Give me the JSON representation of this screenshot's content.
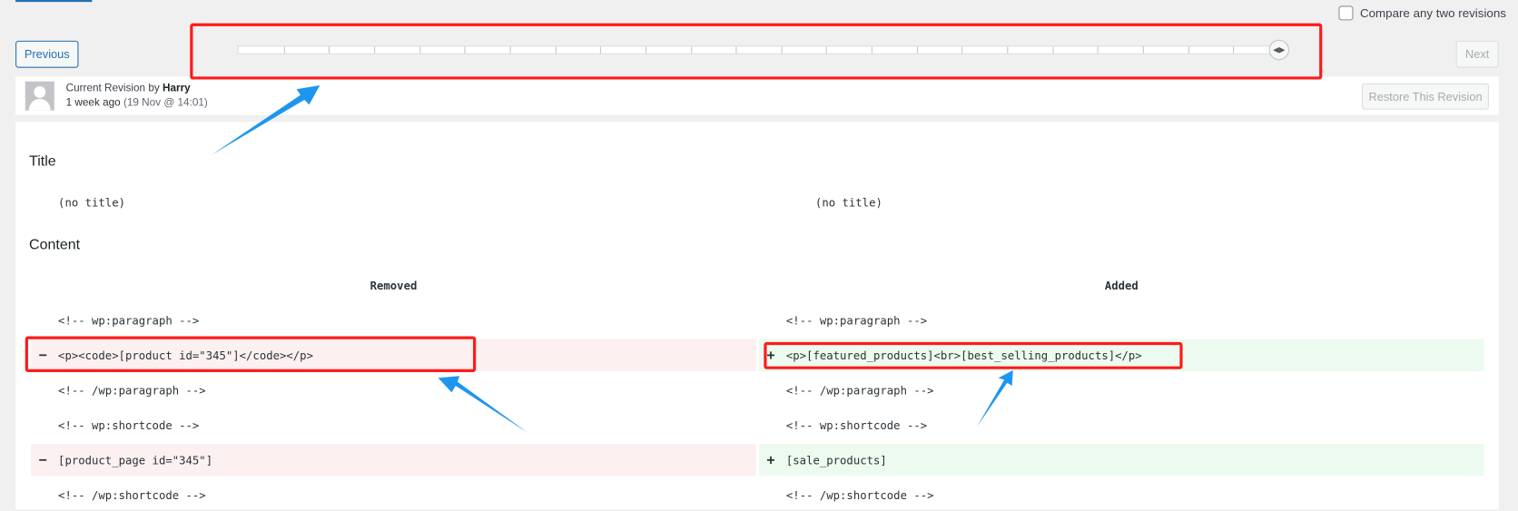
{
  "header": {
    "compare_label": "Compare any two revisions",
    "compare_checked": false,
    "previous_label": "Previous",
    "next_label": "Next",
    "restore_label": "Restore This Revision",
    "revision_prefix": "Current Revision by ",
    "author": "Harry",
    "time_ago": "1 week ago",
    "date": "(19 Nov @ 14:01)",
    "slider_segments": 23,
    "slider_position": 1.0
  },
  "diff": {
    "title_heading": "Title",
    "title_left": "(no title)",
    "title_right": "(no title)",
    "content_heading": "Content",
    "removed_header": "Removed",
    "added_header": "Added",
    "rows": [
      {
        "type": "context",
        "left": "<!-- wp:paragraph -->",
        "right": "<!-- wp:paragraph -->"
      },
      {
        "type": "changed",
        "left": "<p><code>[product id=\"345\"]</code></p>",
        "right": "<p>[featured_products]<br>[best_selling_products]</p>"
      },
      {
        "type": "context",
        "left": "<!-- /wp:paragraph -->",
        "right": "<!-- /wp:paragraph -->"
      },
      {
        "type": "context",
        "left": "<!-- wp:shortcode -->",
        "right": "<!-- wp:shortcode -->"
      },
      {
        "type": "changed",
        "left": "[product_page id=\"345\"]",
        "right": "[sale_products]"
      },
      {
        "type": "context",
        "left": "<!-- /wp:shortcode -->",
        "right": "<!-- /wp:shortcode -->"
      }
    ],
    "minus_sign": "−",
    "plus_sign": "+"
  },
  "colors": {
    "accent": "#2271b1",
    "removed_bg": "#fcf0f1",
    "added_bg": "#edfaef",
    "highlight": "#ff1a1a",
    "arrow": "#1e96f0"
  }
}
